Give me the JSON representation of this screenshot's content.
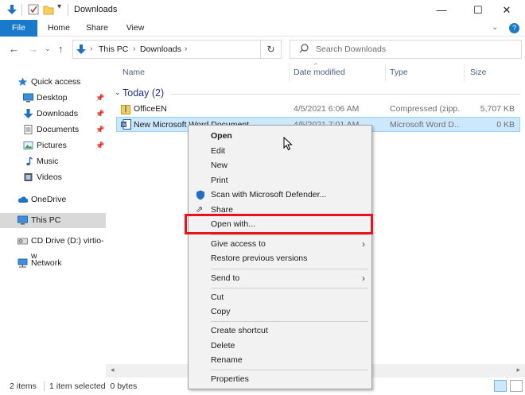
{
  "window": {
    "title": "Downloads",
    "controls": {
      "minimize": "—",
      "maximize": "☐",
      "close": "✕"
    }
  },
  "ribbon": {
    "tabs": [
      "File",
      "Home",
      "Share",
      "View"
    ]
  },
  "address": {
    "path": [
      "This PC",
      "Downloads"
    ],
    "search_placeholder": "Search Downloads"
  },
  "sidebar": {
    "quick_access": "Quick access",
    "items": [
      {
        "label": "Desktop",
        "pinned": true
      },
      {
        "label": "Downloads",
        "pinned": true
      },
      {
        "label": "Documents",
        "pinned": true
      },
      {
        "label": "Pictures",
        "pinned": true
      },
      {
        "label": "Music",
        "pinned": false
      },
      {
        "label": "Videos",
        "pinned": false
      }
    ],
    "onedrive": "OneDrive",
    "this_pc": "This PC",
    "cd_drive": "CD Drive (D:) virtio-w",
    "network": "Network"
  },
  "columns": {
    "name": "Name",
    "date": "Date modified",
    "type": "Type",
    "size": "Size"
  },
  "group": "Today (2)",
  "files": [
    {
      "name": "OfficeEN",
      "date": "4/5/2021 6:06 AM",
      "type": "Compressed (zipp...",
      "size": "5,707 KB"
    },
    {
      "name": "New Microsoft Word Document",
      "date": "4/5/2021 7:01 AM",
      "type": "Microsoft Word D...",
      "size": "0 KB"
    }
  ],
  "status": {
    "count": "2 items",
    "selected": "1 item selected  0 bytes"
  },
  "context_menu": {
    "open": "Open",
    "edit": "Edit",
    "new": "New",
    "print": "Print",
    "scan": "Scan with Microsoft Defender...",
    "share": "Share",
    "open_with": "Open with...",
    "give_access": "Give access to",
    "restore": "Restore previous versions",
    "send_to": "Send to",
    "cut": "Cut",
    "copy": "Copy",
    "create_shortcut": "Create shortcut",
    "delete": "Delete",
    "rename": "Rename",
    "properties": "Properties"
  },
  "colors": {
    "accent": "#1979ca",
    "selection": "#cce8ff",
    "highlight_box": "#e8141b"
  }
}
